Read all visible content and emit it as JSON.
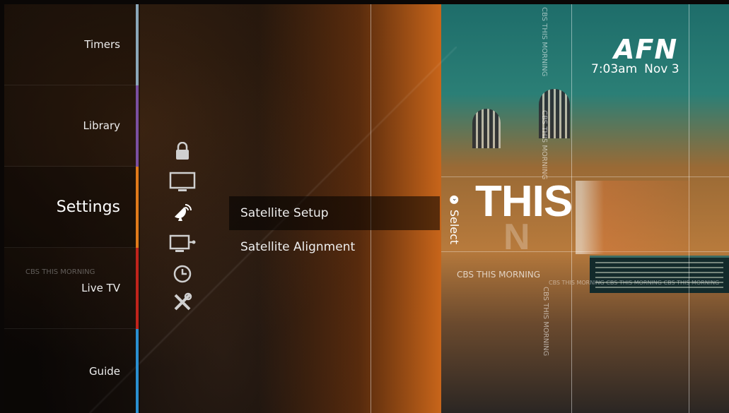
{
  "nav": {
    "items": [
      {
        "label": "Timers",
        "accent": "#8aa6b8"
      },
      {
        "label": "Library",
        "accent": "#7a4fa0"
      },
      {
        "label": "Settings",
        "accent": "#e07a1a"
      },
      {
        "label": "Live TV",
        "accent": "#c0231b"
      },
      {
        "label": "Guide",
        "accent": "#2a8fd0"
      }
    ],
    "active_index": 2
  },
  "settings_icons": [
    {
      "name": "lock-icon",
      "glyph": "🔒"
    },
    {
      "name": "tv-icon",
      "glyph": "🖵"
    },
    {
      "name": "satellite-icon",
      "glyph": "📡"
    },
    {
      "name": "network-icon",
      "glyph": "🖥"
    },
    {
      "name": "clock-icon",
      "glyph": "🕒"
    },
    {
      "name": "tools-icon",
      "glyph": "🛠"
    }
  ],
  "submenu": {
    "items": [
      "Satellite Setup",
      "Satellite Alignment"
    ],
    "active_index": 0
  },
  "select_hint": {
    "label": "Select"
  },
  "brand": {
    "logo": "AFN"
  },
  "clock": {
    "time": "7:03am",
    "date": "Nov 3"
  },
  "promo": {
    "headline": "THIS",
    "ghost_text": "N",
    "strip_text": "CBS THIS MORNING",
    "strip_text_repeated": "CBS THIS MORNING  CBS THIS MORNING  CBS THIS MORNING"
  }
}
